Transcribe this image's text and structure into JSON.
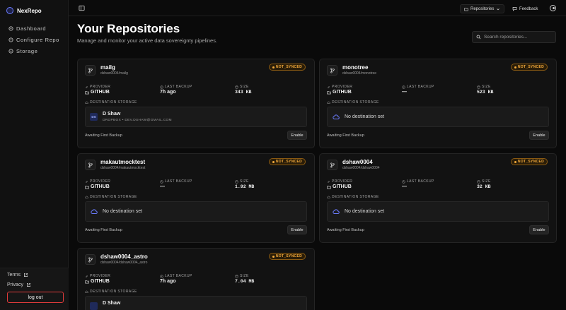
{
  "app": {
    "name": "NexRepo"
  },
  "nav": [
    {
      "label": "Dashboard",
      "icon": "dashboard-icon"
    },
    {
      "label": "Configure Repo",
      "icon": "configure-icon"
    },
    {
      "label": "Storage",
      "icon": "storage-icon"
    }
  ],
  "footer": {
    "terms": "Terms",
    "privacy": "Privacy",
    "logout": "log out"
  },
  "topbar": {
    "repo_selector": "Repositories",
    "feedback": "Feedback"
  },
  "page": {
    "title": "Your Repositories",
    "subtitle": "Manage and monitor your active data sovereignty pipelines.",
    "search_placeholder": "Search repositories..."
  },
  "labels": {
    "provider": "PROVIDER",
    "last_backup": "LAST BACKUP",
    "size": "SIZE",
    "destination": "DESTINATION STORAGE",
    "no_destination": "No destination set",
    "enable": "Enable"
  },
  "repos": [
    {
      "name": "mailg",
      "path": "dshaw0004/mailg",
      "status": "NOT_SYNCED",
      "provider": "GITHUB",
      "last_backup": "7h ago",
      "size": "343 KB",
      "dest_name": "D Shaw",
      "dest_initials": "DS",
      "dest_detail": "DROPBOX • DEV.DSHAW@GMAIL.COM",
      "state": "Awaiting First Backup"
    },
    {
      "name": "monotree",
      "path": "dshaw0004/monotree",
      "status": "NOT_SYNCED",
      "provider": "GITHUB",
      "last_backup": "—",
      "size": "523 KB",
      "state": "Awaiting First Backup"
    },
    {
      "name": "makautmocktest",
      "path": "dshaw0004/makautmocktest",
      "status": "NOT_SYNCED",
      "provider": "GITHUB",
      "last_backup": "—",
      "size": "1.92 MB",
      "state": "Awaiting First Backup"
    },
    {
      "name": "dshaw0004",
      "path": "dshaw0004/dshaw0004",
      "status": "NOT_SYNCED",
      "provider": "GITHUB",
      "last_backup": "—",
      "size": "32 KB",
      "state": "Awaiting First Backup"
    },
    {
      "name": "dshaw0004_astro",
      "path": "dshaw0004/dshaw0004_astro",
      "status": "NOT_SYNCED",
      "provider": "GITHUB",
      "last_backup": "7h ago",
      "size": "7.04 MB",
      "dest_name": "D Shaw"
    }
  ],
  "colors": {
    "accent": "#6b7cff",
    "warning": "#f2a93b",
    "danger": "#e03b3b"
  }
}
